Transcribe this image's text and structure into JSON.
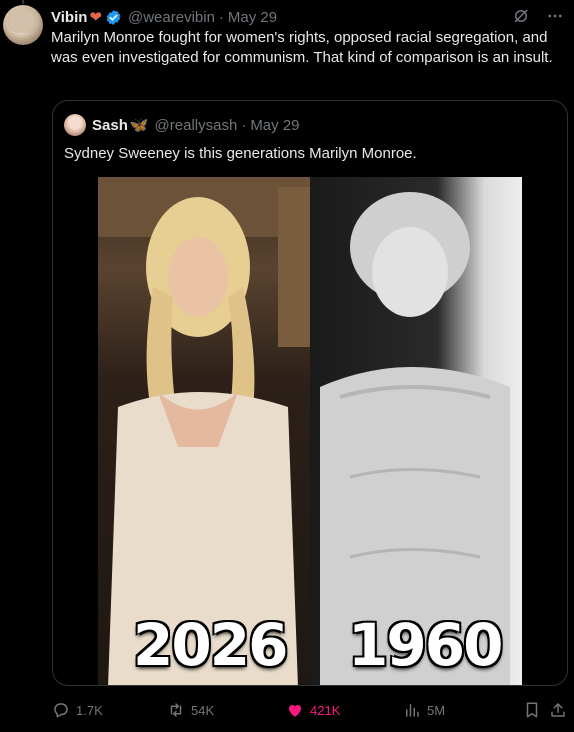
{
  "tweet": {
    "display_name": "Vibin",
    "name_badge": "heart",
    "handle": "@wearevibin",
    "separator": "·",
    "date": "May 29",
    "text": "Marilyn Monroe fought for women's rights, opposed racial segregation, and was even investigated for communism. That kind of comparison is an insult."
  },
  "quote": {
    "display_name": "Sash",
    "name_badge": "butterfly",
    "handle": "@reallysash",
    "separator": "·",
    "date": "May 29",
    "text": "Sydney Sweeney is this generations Marilyn Monroe.",
    "image": {
      "left_label": "2026",
      "right_label": "1960"
    }
  },
  "actions": {
    "reply_count": "1.7K",
    "retweet_count": "54K",
    "like_count": "421K",
    "views_count": "5M"
  },
  "colors": {
    "background": "#000000",
    "text": "#e7e9ea",
    "muted": "#71767b",
    "like": "#f91880",
    "verified": "#1d9bf0"
  },
  "icons": [
    "grok-icon",
    "more-icon",
    "verified-icon",
    "reply-icon",
    "retweet-icon",
    "like-icon",
    "views-icon",
    "bookmark-icon",
    "share-icon"
  ]
}
